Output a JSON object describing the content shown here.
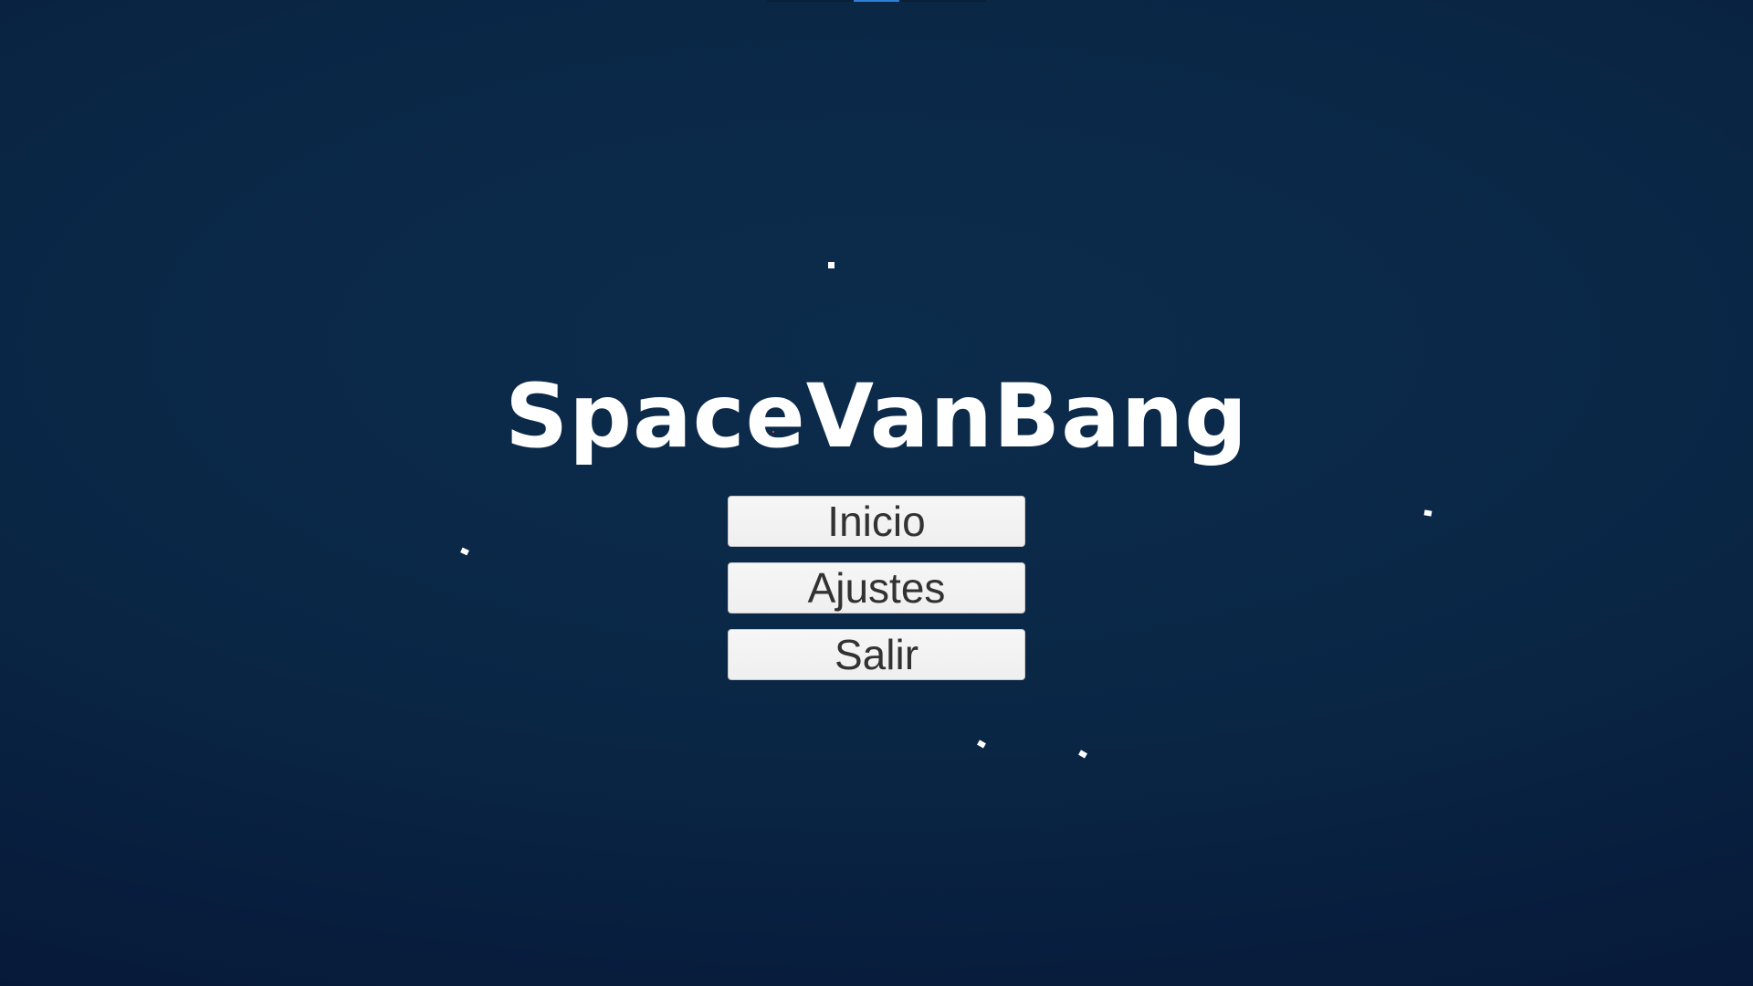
{
  "game": {
    "title": "SpaceVanBang"
  },
  "main_menu": {
    "buttons": [
      {
        "label": "Inicio"
      },
      {
        "label": "Ajustes"
      },
      {
        "label": "Salir"
      }
    ]
  },
  "colors": {
    "background_top": "#0c2c4c",
    "background_bottom": "#061535",
    "title_text": "#ffffff",
    "button_face": "#f4f4f4",
    "button_text": "#323232",
    "star": "#ffffff"
  }
}
